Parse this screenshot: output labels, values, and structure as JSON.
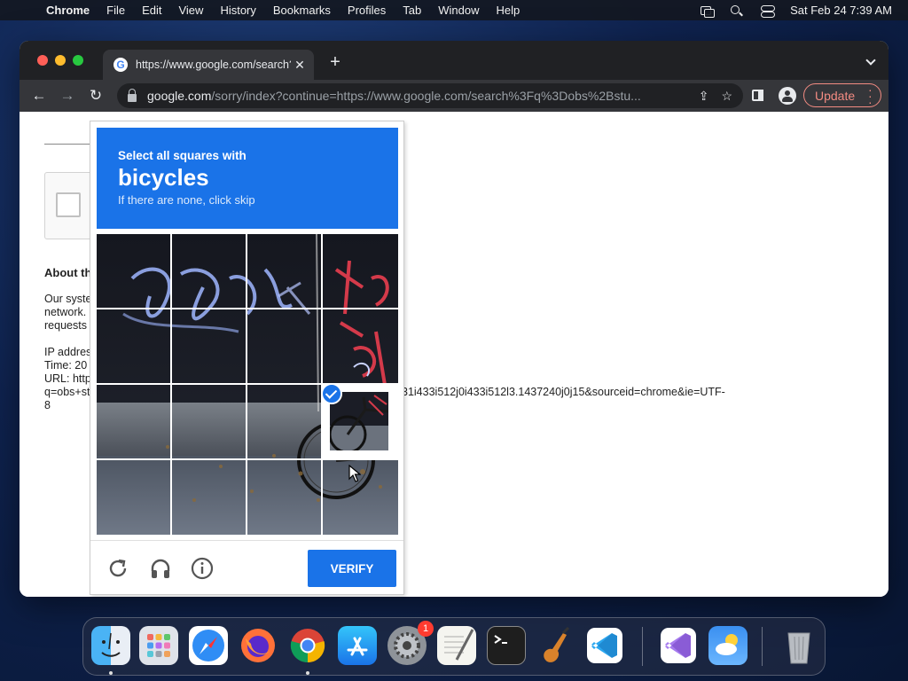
{
  "menubar": {
    "app_name": "Chrome",
    "items": [
      "File",
      "Edit",
      "View",
      "History",
      "Bookmarks",
      "Profiles",
      "Tab",
      "Window",
      "Help"
    ],
    "clock": "Sat Feb 24  7:39 AM"
  },
  "browser": {
    "tab_title": "https://www.google.com/search?q",
    "url_host": "google.com",
    "url_rest": "/sorry/index?continue=https://www.google.com/search%3Fq%3Dobs%2Bstu...",
    "update_label": "Update"
  },
  "page": {
    "about_heading": "About th",
    "para1_lines": [
      "Our syste",
      "network.",
      "requests"
    ],
    "para2_lines": [
      "IP addres",
      "Time: 20",
      "URL: http",
      "q=obs+st",
      "8"
    ],
    "url_tail": "31i433i512j0i433i512l3.1437240j0j15&sourceid=chrome&ie=UTF-"
  },
  "captcha": {
    "instruction": "Select all squares with",
    "target": "bicycles",
    "hint": "If there are none, click skip",
    "verify_label": "VERIFY",
    "selected_tiles": [
      12
    ]
  },
  "dock": {
    "apps": [
      "Finder",
      "Launchpad",
      "Safari",
      "Firefox",
      "Chrome",
      "App Store",
      "System Settings",
      "TextEdit",
      "Terminal",
      "GarageBand",
      "Visual Studio Code",
      "Visual Studio",
      "Weather",
      "Trash"
    ],
    "settings_badge": "1"
  }
}
